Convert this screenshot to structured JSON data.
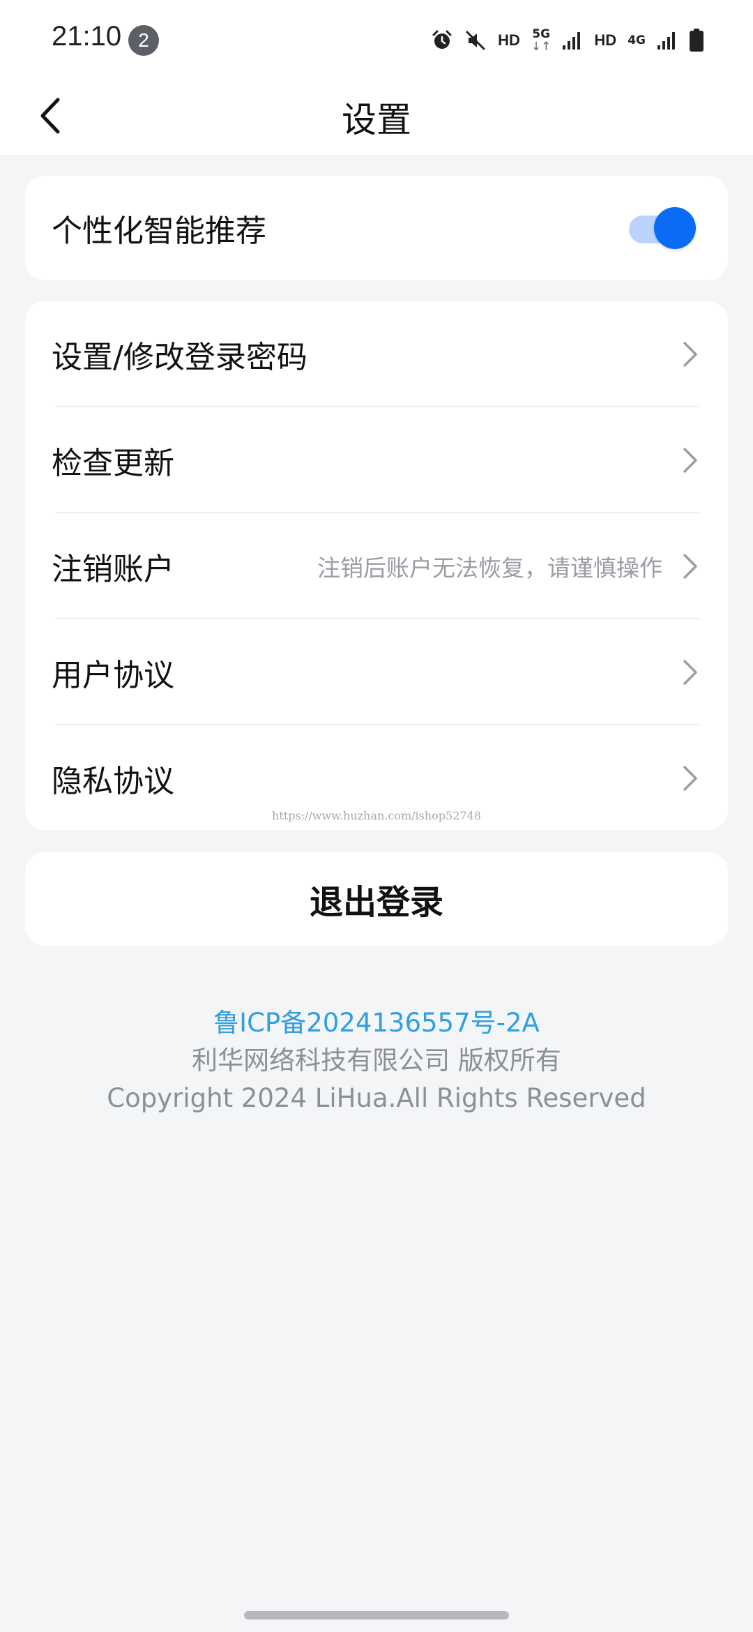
{
  "status_bar": {
    "time": "21:10",
    "notification_count": "2",
    "hd1": "HD",
    "network_5g": "5G",
    "network_5g_arrows": "↓↑",
    "hd2": "HD",
    "network_4g": "4G",
    "icons": [
      "alarm-icon",
      "mute-icon",
      "signal-icon",
      "signal-icon",
      "battery-icon"
    ]
  },
  "header": {
    "title": "设置"
  },
  "toggle_card": {
    "label": "个性化智能推荐",
    "enabled": true,
    "accent_color": "#0a6cf5"
  },
  "settings_list": [
    {
      "label": "设置/修改登录密码",
      "hint": ""
    },
    {
      "label": "检查更新",
      "hint": ""
    },
    {
      "label": "注销账户",
      "hint": "注销后账户无法恢复，请谨慎操作"
    },
    {
      "label": "用户协议",
      "hint": ""
    },
    {
      "label": "隐私协议",
      "hint": ""
    }
  ],
  "watermark": "https://www.huzhan.com/ishop52748",
  "logout_label": "退出登录",
  "footer": {
    "icp": "鲁ICP备2024136557号-2A",
    "company": "利华网络科技有限公司 版权所有",
    "copyright": "Copyright 2024 LiHua.All Rights Reserved"
  }
}
